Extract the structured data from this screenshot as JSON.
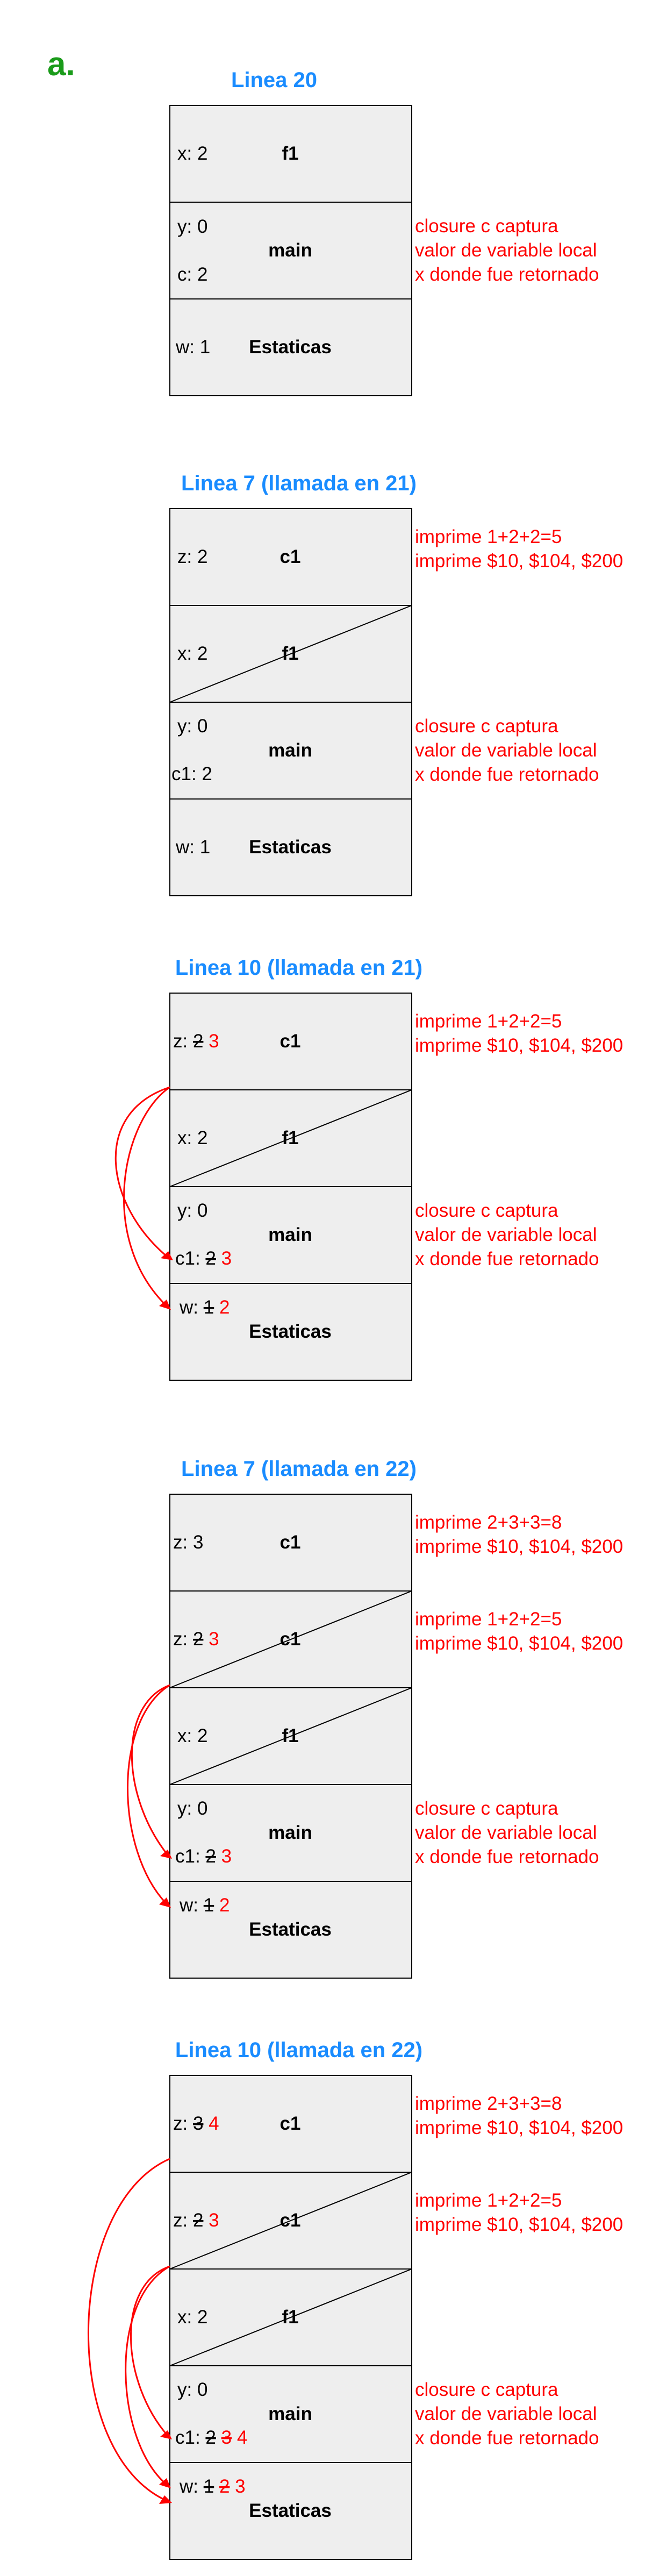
{
  "label": "a.",
  "colors": {
    "header": "#1a8cff",
    "note": "#ff0000",
    "frame": "#eeeeee",
    "letter": "#1a9b1a"
  },
  "notes": {
    "closure": [
      "closure c captura",
      "valor de variable local",
      "x donde fue retornado"
    ],
    "print1": [
      "imprime 1+2+2=5",
      "imprime $10, $104, $200"
    ],
    "print2": [
      "imprime 2+3+3=8",
      "imprime $10, $104, $200"
    ]
  },
  "names": {
    "f1": "f1",
    "main": "main",
    "c1": "c1",
    "static": "Estaticas"
  },
  "diagrams": [
    {
      "title": "Linea 20",
      "frames": [
        {
          "name": "f1",
          "lines": [
            "x: 2"
          ]
        },
        {
          "name": "main",
          "lines": [
            "y: 0",
            "c: 2"
          ],
          "note": "closure"
        },
        {
          "name": "Estaticas",
          "lines": [
            "w: 1"
          ]
        }
      ]
    },
    {
      "title": "Linea 7 (llamada en 21)",
      "frames": [
        {
          "name": "c1",
          "lines": [
            "z: 2"
          ],
          "note": "print1"
        },
        {
          "name": "f1",
          "lines": [
            "x: 2"
          ],
          "slash": true
        },
        {
          "name": "main",
          "lines": [
            "y: 0",
            "c1: 2"
          ],
          "note": "closure"
        },
        {
          "name": "Estaticas",
          "lines": [
            "w: 1"
          ]
        }
      ]
    },
    {
      "title": "Linea 10 (llamada en 21)",
      "frames": [
        {
          "name": "c1",
          "lines": [
            "z: 2 3"
          ],
          "note": "print1"
        },
        {
          "name": "f1",
          "lines": [
            "x: 2"
          ],
          "slash": true
        },
        {
          "name": "main",
          "lines": [
            "y: 0",
            "c1: 2 3"
          ],
          "note": "closure"
        },
        {
          "name": "Estaticas",
          "lines": [
            "w: 1 2"
          ]
        }
      ]
    },
    {
      "title": "Linea 7 (llamada en 22)",
      "frames": [
        {
          "name": "c1",
          "lines": [
            "z: 3"
          ],
          "note": "print2"
        },
        {
          "name": "c1",
          "lines": [
            "z: 2 3"
          ],
          "note": "print1",
          "slash": true
        },
        {
          "name": "f1",
          "lines": [
            "x: 2"
          ],
          "slash": true
        },
        {
          "name": "main",
          "lines": [
            "y: 0",
            "c1: 2 3"
          ],
          "note": "closure"
        },
        {
          "name": "Estaticas",
          "lines": [
            "w: 1 2"
          ]
        }
      ]
    },
    {
      "title": "Linea 10 (llamada en 22)",
      "frames": [
        {
          "name": "c1",
          "lines": [
            "z: 3 4"
          ],
          "note": "print2"
        },
        {
          "name": "c1",
          "lines": [
            "z: 2 3"
          ],
          "note": "print1",
          "slash": true
        },
        {
          "name": "f1",
          "lines": [
            "x: 2"
          ],
          "slash": true
        },
        {
          "name": "main",
          "lines": [
            "y: 0",
            "c1: 2 3 4"
          ],
          "note": "closure"
        },
        {
          "name": "Estaticas",
          "lines": [
            "w: 1 2 3"
          ]
        }
      ]
    }
  ]
}
